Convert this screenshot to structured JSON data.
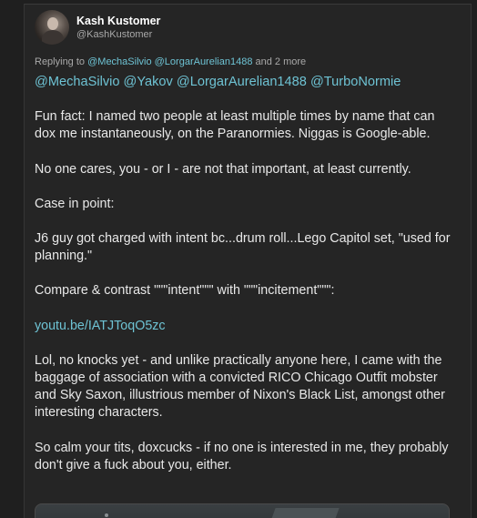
{
  "author": {
    "display_name": "Kash Kustomer",
    "handle": "@KashKustomer"
  },
  "replying": {
    "prefix": "Replying to",
    "mention_1": "@MechaSilvio",
    "mention_2": "@LorgarAurelian1488",
    "suffix": "and 2 more"
  },
  "post": {
    "mentions": "@MechaSilvio @Yakov @LorgarAurelian1488 @TurboNormie",
    "p1": "Fun fact: I named two people at least multiple times by name that can dox me instantaneously, on the Paranormies. Niggas is Google-able.",
    "p2": "No one cares, you - or I - are not that important, at least currently.",
    "p3": "Case in point:",
    "p4": "J6 guy got charged with intent bc...drum roll...Lego Capitol set, \"used for planning.\"",
    "p5": "Compare & contrast \"\"\"intent\"\"\" with \"\"\"incitement\"\"\":",
    "link": "youtu.be/IATJToqO5zc",
    "p6": "Lol, no knocks yet - and unlike practically anyone here, I came with the baggage of association with a convicted RICO Chicago Outfit mobster and Sky Saxon, illustrious member of Nixon's Black List, amongst other interesting characters.",
    "p7": "So calm your tits, doxcucks - if no one is interested in me, they probably don't give a fuck about you, either."
  },
  "colors": {
    "background": "#1f1f1f",
    "card": "#252525",
    "mention": "#6ec3d4",
    "text": "#e8e8e8",
    "muted": "#a9a9a9"
  }
}
